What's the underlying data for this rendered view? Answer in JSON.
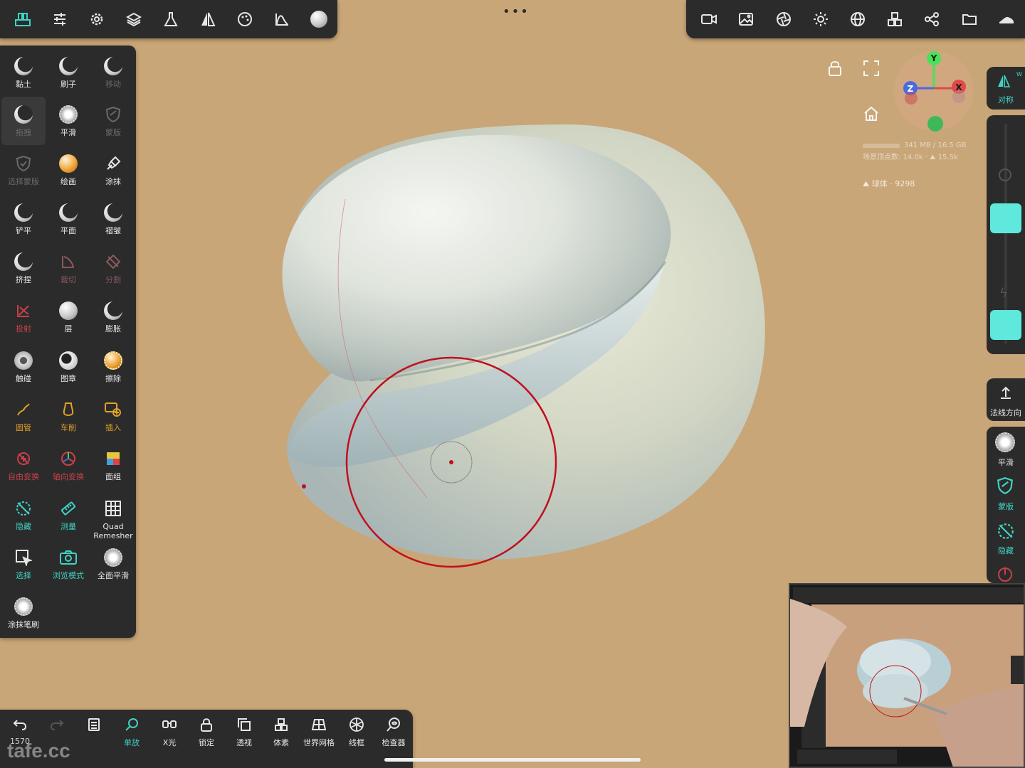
{
  "top_left_toolbar": {
    "buttons": [
      "tools-icon",
      "sliders-icon",
      "gear-icon",
      "layers-icon",
      "flask-icon",
      "symmetry-icon",
      "palette-icon",
      "curve-icon",
      "material-icon"
    ]
  },
  "top_center": {
    "grip": "•••"
  },
  "top_right_toolbar": {
    "buttons": [
      "camera-icon",
      "image-icon",
      "aperture-icon",
      "sun-icon",
      "sphere-grid-icon",
      "cubes-icon",
      "share-icon",
      "folder-icon",
      "shoe-icon"
    ]
  },
  "tools": [
    {
      "label": "黏土",
      "color": "white"
    },
    {
      "label": "刷子",
      "color": "white"
    },
    {
      "label": "移动",
      "color": "dim"
    },
    {
      "label": "拖拽",
      "color": "dim"
    },
    {
      "label": "平滑",
      "color": "white"
    },
    {
      "label": "蒙版",
      "color": "dim"
    },
    {
      "label": "选择蒙版",
      "color": "dim"
    },
    {
      "label": "绘画",
      "color": "white"
    },
    {
      "label": "涂抹",
      "color": "white"
    },
    {
      "label": "铲平",
      "color": "white"
    },
    {
      "label": "平面",
      "color": "white"
    },
    {
      "label": "褶皱",
      "color": "white"
    },
    {
      "label": "挤捏",
      "color": "white"
    },
    {
      "label": "裁切",
      "color": "pinkdim"
    },
    {
      "label": "分割",
      "color": "pinkdim"
    },
    {
      "label": "投射",
      "color": "red"
    },
    {
      "label": "层",
      "color": "white"
    },
    {
      "label": "膨胀",
      "color": "white"
    },
    {
      "label": "触碰",
      "color": "white"
    },
    {
      "label": "图章",
      "color": "white"
    },
    {
      "label": "擦除",
      "color": "white"
    },
    {
      "label": "圆管",
      "color": "orange"
    },
    {
      "label": "车削",
      "color": "orange"
    },
    {
      "label": "插入",
      "color": "orange"
    },
    {
      "label": "自由变换",
      "color": "red"
    },
    {
      "label": "轴向变换",
      "color": "red"
    },
    {
      "label": "面组",
      "color": "white"
    },
    {
      "label": "隐藏",
      "color": "teal"
    },
    {
      "label": "测量",
      "color": "teal"
    },
    {
      "label": "Quad Remesher",
      "color": "white"
    },
    {
      "label": "选择",
      "color": "teal"
    },
    {
      "label": "浏览模式",
      "color": "teal"
    },
    {
      "label": "全面平滑",
      "color": "white"
    },
    {
      "label": "涂抹笔刷",
      "color": "white"
    }
  ],
  "bottom_toolbar": {
    "undo_count": "1570",
    "items": [
      {
        "label": "单放",
        "icon": "lasso-icon"
      },
      {
        "label": "X光",
        "icon": "xray-icon"
      },
      {
        "label": "锁定",
        "icon": "lock-icon"
      },
      {
        "label": "透视",
        "icon": "perspective-icon"
      },
      {
        "label": "体素",
        "icon": "voxel-icon"
      },
      {
        "label": "世界网格",
        "icon": "world-grid-icon"
      },
      {
        "label": "线框",
        "icon": "wireframe-icon"
      },
      {
        "label": "检查器",
        "icon": "inspector-icon"
      }
    ]
  },
  "watermark": "tafe.cc",
  "viewport": {
    "axis_y": "Y",
    "axis_x": "X",
    "axis_z": "Z",
    "memory": "341 MB / 16.5 GB",
    "vertices": "场景顶点数: 14.0k · ⛰ 15.5k",
    "mesh": "⛰ 球体 · 9298"
  },
  "right_panel": {
    "symmetry_label": "对称",
    "symmetry_badge": "W",
    "normal_label": "法线方向",
    "smooth_label": "平滑",
    "mask_label": "蒙版",
    "hide_label": "隐藏"
  },
  "colors": {
    "background": "#c9a677",
    "panel": "#2b2b2b",
    "accent": "#3fd3c4",
    "brush_ring": "#c0101e",
    "model": "#cfd8d4"
  }
}
